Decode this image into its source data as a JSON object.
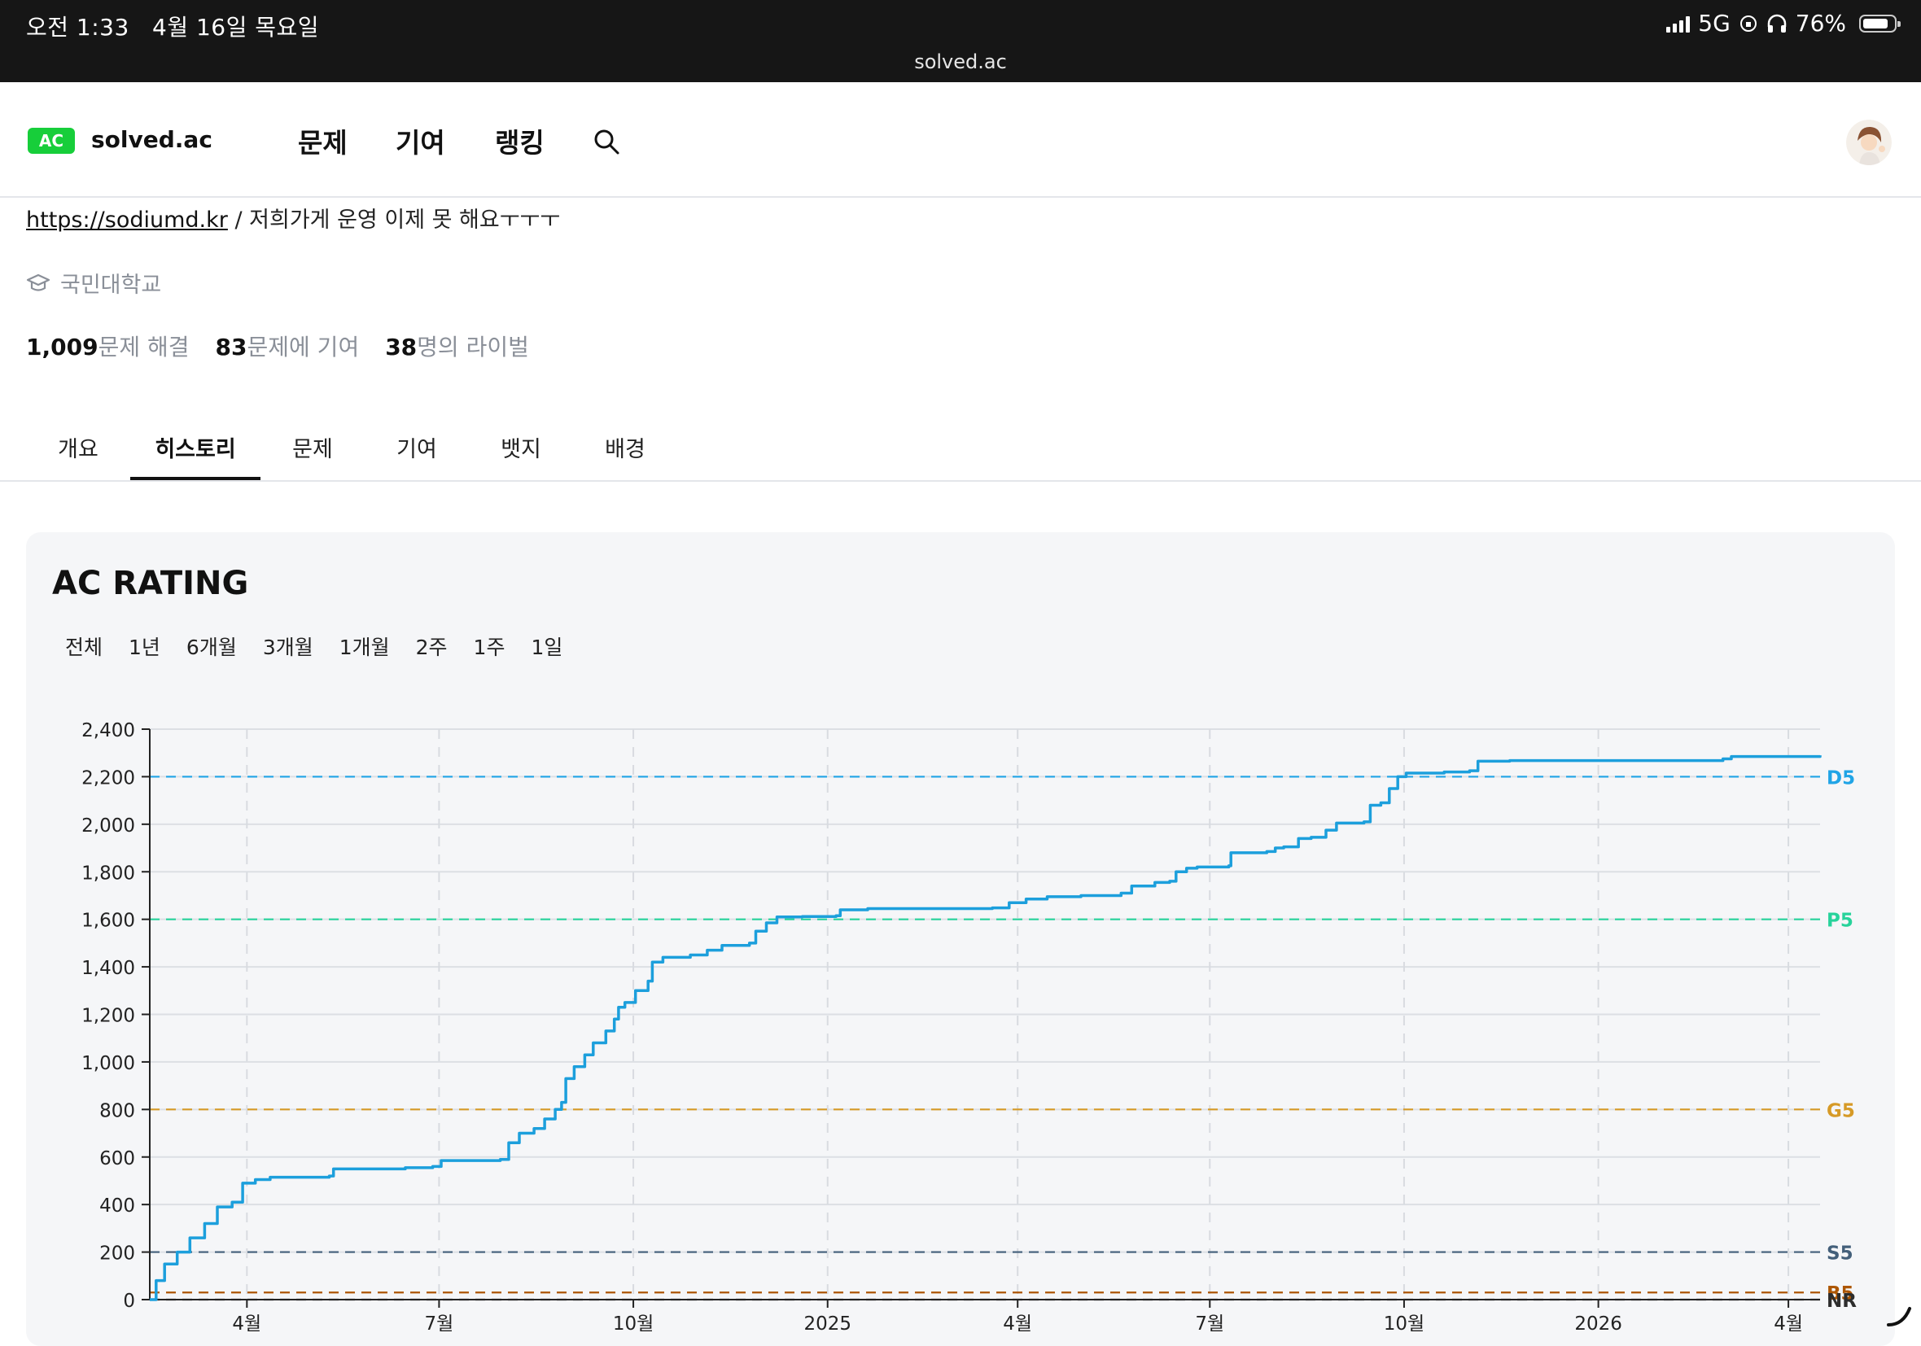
{
  "status_bar": {
    "time": "오전 1:33",
    "date": "4월 16일 목요일",
    "network": "5G",
    "battery": "76%",
    "url": "solved.ac"
  },
  "nav": {
    "logo_badge": "AC",
    "logo_text": "solved.ac",
    "links": [
      "문제",
      "기여",
      "랭킹"
    ]
  },
  "profile": {
    "bio_link": "https://sodiumd.kr",
    "bio_text": " / 저희가게 운영 이제 못 해요ㅜㅜㅜ",
    "school": "국민대학교",
    "solved_count": "1,009",
    "solved_label": "문제 해결",
    "contrib_count": "83",
    "contrib_label": "문제에 기여",
    "rival_count": "38",
    "rival_label": "명의 라이벌"
  },
  "tabs": [
    "개요",
    "히스토리",
    "문제",
    "기여",
    "뱃지",
    "배경"
  ],
  "active_tab": "히스토리",
  "card": {
    "title": "AC RATING",
    "ranges": [
      "전체",
      "1년",
      "6개월",
      "3개월",
      "1개월",
      "2주",
      "1주",
      "1일"
    ]
  },
  "colors": {
    "line": "#1c9fdc",
    "D5": "#20a4e6",
    "P5": "#27d39b",
    "G5": "#d69a27",
    "S5": "#435f7a",
    "B5": "#ad5600",
    "NR": "#2d2d2d",
    "accent_green": "#17ce3a"
  },
  "chart_data": {
    "type": "line",
    "title": "AC RATING",
    "ylim": [
      0,
      2400
    ],
    "y_ticks": [
      "0",
      "200",
      "400",
      "600",
      "800",
      "1,000",
      "1,200",
      "1,400",
      "1,600",
      "1,800",
      "2,000",
      "2,200",
      "2,400"
    ],
    "x_range": [
      "2024-02-15",
      "2026-04-16"
    ],
    "x_ticks": [
      {
        "date": "2024-04-01",
        "label": "4월"
      },
      {
        "date": "2024-07-01",
        "label": "7월"
      },
      {
        "date": "2024-10-01",
        "label": "10월"
      },
      {
        "date": "2025-01-01",
        "label": "2025"
      },
      {
        "date": "2025-04-01",
        "label": "4월"
      },
      {
        "date": "2025-07-01",
        "label": "7월"
      },
      {
        "date": "2025-10-01",
        "label": "10월"
      },
      {
        "date": "2026-01-01",
        "label": "2026"
      },
      {
        "date": "2026-04-01",
        "label": "4월"
      }
    ],
    "tier_lines": [
      {
        "label": "D5",
        "value": 2200
      },
      {
        "label": "P5",
        "value": 1600
      },
      {
        "label": "G5",
        "value": 800
      },
      {
        "label": "S5",
        "value": 200
      },
      {
        "label": "B5",
        "value": 30
      },
      {
        "label": "NR",
        "value": 0
      }
    ],
    "series": [
      {
        "points": [
          [
            "2024-02-15",
            0
          ],
          [
            "2024-02-18",
            80
          ],
          [
            "2024-02-22",
            150
          ],
          [
            "2024-02-28",
            200
          ],
          [
            "2024-03-05",
            260
          ],
          [
            "2024-03-12",
            320
          ],
          [
            "2024-03-18",
            390
          ],
          [
            "2024-03-25",
            410
          ],
          [
            "2024-03-30",
            490
          ],
          [
            "2024-04-05",
            505
          ],
          [
            "2024-04-12",
            515
          ],
          [
            "2024-05-10",
            520
          ],
          [
            "2024-05-12",
            550
          ],
          [
            "2024-06-15",
            555
          ],
          [
            "2024-06-28",
            560
          ],
          [
            "2024-07-02",
            585
          ],
          [
            "2024-07-30",
            590
          ],
          [
            "2024-08-03",
            660
          ],
          [
            "2024-08-08",
            700
          ],
          [
            "2024-08-15",
            720
          ],
          [
            "2024-08-20",
            760
          ],
          [
            "2024-08-25",
            800
          ],
          [
            "2024-08-28",
            830
          ],
          [
            "2024-08-30",
            930
          ],
          [
            "2024-09-03",
            980
          ],
          [
            "2024-09-08",
            1030
          ],
          [
            "2024-09-12",
            1080
          ],
          [
            "2024-09-18",
            1130
          ],
          [
            "2024-09-22",
            1180
          ],
          [
            "2024-09-24",
            1230
          ],
          [
            "2024-09-27",
            1250
          ],
          [
            "2024-10-02",
            1300
          ],
          [
            "2024-10-08",
            1340
          ],
          [
            "2024-10-10",
            1420
          ],
          [
            "2024-10-15",
            1440
          ],
          [
            "2024-10-28",
            1450
          ],
          [
            "2024-11-05",
            1470
          ],
          [
            "2024-11-12",
            1490
          ],
          [
            "2024-11-25",
            1500
          ],
          [
            "2024-11-28",
            1550
          ],
          [
            "2024-12-03",
            1585
          ],
          [
            "2024-12-08",
            1610
          ],
          [
            "2024-12-20",
            1612
          ],
          [
            "2025-01-05",
            1615
          ],
          [
            "2025-01-07",
            1640
          ],
          [
            "2025-01-20",
            1645
          ],
          [
            "2025-03-20",
            1648
          ],
          [
            "2025-03-28",
            1670
          ],
          [
            "2025-04-05",
            1685
          ],
          [
            "2025-04-15",
            1695
          ],
          [
            "2025-05-01",
            1700
          ],
          [
            "2025-05-20",
            1710
          ],
          [
            "2025-05-25",
            1740
          ],
          [
            "2025-06-05",
            1755
          ],
          [
            "2025-06-12",
            1760
          ],
          [
            "2025-06-15",
            1800
          ],
          [
            "2025-06-20",
            1815
          ],
          [
            "2025-06-25",
            1820
          ],
          [
            "2025-07-10",
            1825
          ],
          [
            "2025-07-11",
            1880
          ],
          [
            "2025-07-28",
            1885
          ],
          [
            "2025-08-01",
            1900
          ],
          [
            "2025-08-05",
            1905
          ],
          [
            "2025-08-12",
            1940
          ],
          [
            "2025-08-18",
            1945
          ],
          [
            "2025-08-25",
            1975
          ],
          [
            "2025-08-30",
            2005
          ],
          [
            "2025-09-12",
            2010
          ],
          [
            "2025-09-15",
            2080
          ],
          [
            "2025-09-20",
            2090
          ],
          [
            "2025-09-24",
            2150
          ],
          [
            "2025-09-28",
            2200
          ],
          [
            "2025-10-02",
            2215
          ],
          [
            "2025-10-20",
            2220
          ],
          [
            "2025-11-01",
            2225
          ],
          [
            "2025-11-05",
            2265
          ],
          [
            "2025-11-20",
            2268
          ],
          [
            "2026-02-01",
            2268
          ],
          [
            "2026-03-01",
            2275
          ],
          [
            "2026-03-05",
            2285
          ],
          [
            "2026-04-16",
            2290
          ]
        ]
      }
    ]
  }
}
